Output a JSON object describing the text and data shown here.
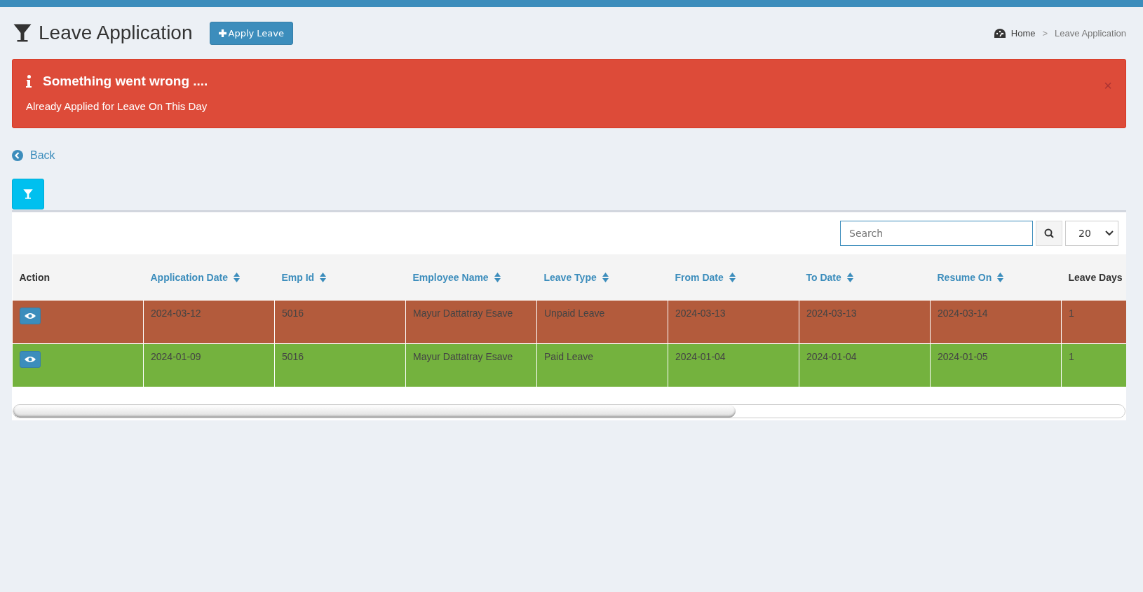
{
  "header": {
    "title": "Leave Application",
    "apply_button": "Apply Leave"
  },
  "breadcrumb": {
    "items": [
      {
        "label": "Home",
        "kind": "home"
      },
      {
        "label": "Leave Application",
        "kind": "current"
      }
    ],
    "separator": ">"
  },
  "alert": {
    "title": "Something went wrong ....",
    "message": "Already Applied for Leave On This Day",
    "close": "×"
  },
  "back_link": "Back",
  "toolbar": {
    "search": {
      "placeholder": "Search"
    },
    "page_size": "20"
  },
  "table": {
    "columns": [
      {
        "label": "Action",
        "sortable": false
      },
      {
        "label": "Application Date",
        "sortable": true
      },
      {
        "label": "Emp Id",
        "sortable": true
      },
      {
        "label": "Employee Name",
        "sortable": true
      },
      {
        "label": "Leave Type",
        "sortable": true
      },
      {
        "label": "From Date",
        "sortable": true
      },
      {
        "label": "To Date",
        "sortable": true
      },
      {
        "label": "Resume On",
        "sortable": true
      },
      {
        "label": "Leave Days",
        "sortable": false
      }
    ],
    "rows": [
      {
        "color": "#b35b3c",
        "cells": [
          "",
          "2024-03-12",
          "5016",
          "Mayur Dattatray Esave",
          "Unpaid Leave",
          "2024-03-13",
          "2024-03-13",
          "2024-03-14",
          "1"
        ]
      },
      {
        "color": "#74b23e",
        "cells": [
          "",
          "2024-01-09",
          "5016",
          "Mayur Dattatray Esave",
          "Paid Leave",
          "2024-01-04",
          "2024-01-04",
          "2024-01-05",
          "1"
        ]
      }
    ]
  }
}
